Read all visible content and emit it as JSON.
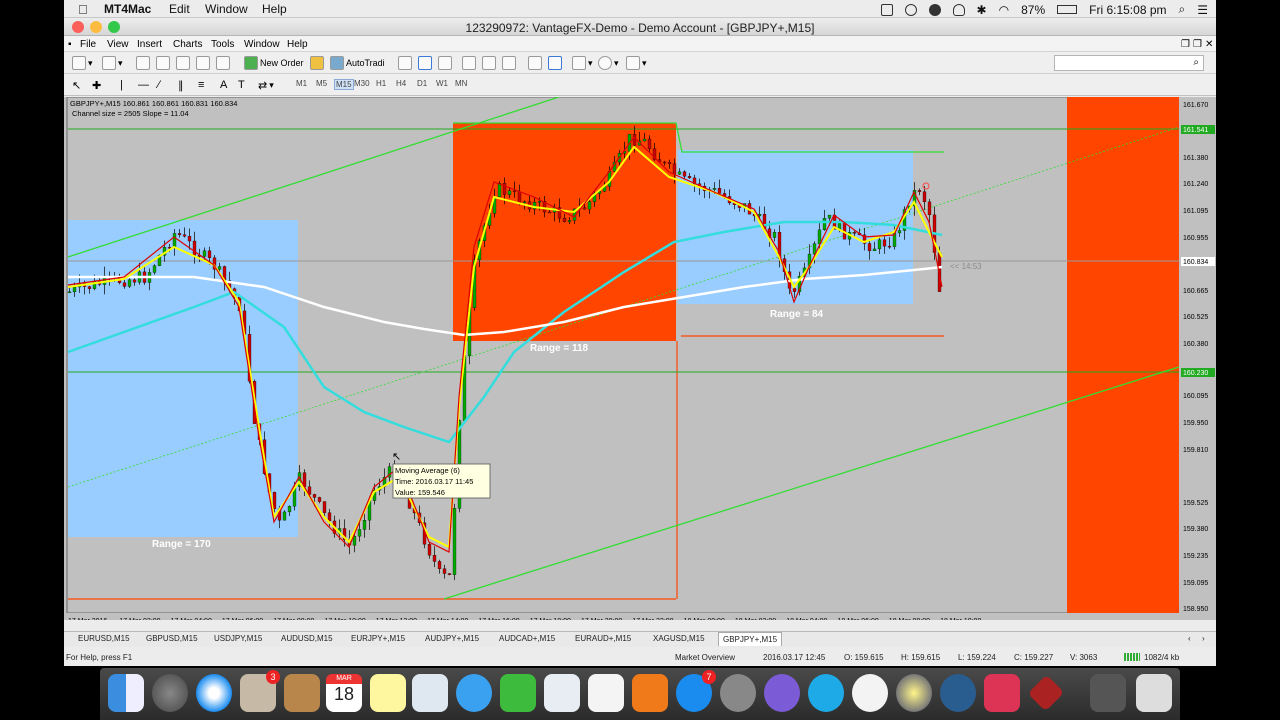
{
  "menubar": {
    "app": "MT4Mac",
    "items": [
      "Edit",
      "Window",
      "Help"
    ],
    "battery": "87%",
    "clock": "Fri 6:15:08 pm"
  },
  "window": {
    "title": "123290972: VantageFX-Demo - Demo Account - [GBPJPY+,M15]",
    "menu": [
      "File",
      "View",
      "Insert",
      "Charts",
      "Tools",
      "Window",
      "Help"
    ],
    "toolbar": {
      "new_order": "New Order",
      "autotrading": "AutoTradi"
    },
    "timeframes": [
      "M1",
      "M5",
      "M15",
      "M30",
      "H1",
      "H4",
      "D1",
      "W1",
      "MN"
    ],
    "active_timeframe": "M15"
  },
  "chart": {
    "header_line1": "GBPJPY+,M15  160.861 160.861 160.831 160.834",
    "header_line2": "Channel size = 2505  Slope = 11.04",
    "range_labels": [
      "Range = 170",
      "Range = 118",
      "Range = 84"
    ],
    "price_ticks": [
      "161.670",
      "161.380",
      "161.240",
      "161.095",
      "160.955",
      "160.665",
      "160.525",
      "160.380",
      "160.095",
      "159.950",
      "159.810",
      "159.525",
      "159.380",
      "159.235",
      "159.095",
      "158.950"
    ],
    "price_markers": [
      "161.541",
      "160.834",
      "160.230"
    ],
    "time_ticks": [
      "17 Mar 2016",
      "17 Mar 02:00",
      "17 Mar 04:00",
      "17 Mar 06:00",
      "17 Mar 08:00",
      "17 Mar 10:00",
      "17 Mar 12:00",
      "17 Mar 14:00",
      "17 Mar 16:00",
      "17 Mar 18:00",
      "17 Mar 20:00",
      "17 Mar 22:00",
      "18 Mar 00:00",
      "18 Mar 02:00",
      "18 Mar 04:00",
      "18 Mar 06:00",
      "18 Mar 08:00",
      "18 Mar 10:00"
    ],
    "countdown": "<< 14:53",
    "tooltip": {
      "line1": "Moving Average (6)",
      "line2": "Time: 2016.03.17 11:45",
      "line3": "Value: 159.546"
    },
    "colors": {
      "background": "#c0c0c0",
      "range_box_blue": "#99ccff",
      "range_box_orange": "#ff4500",
      "channel": "#33dd33",
      "ma_fast": "#ffff00",
      "ma_slow": "#ffffff",
      "ma_cyan": "#33dddd",
      "bull": "#00aa00",
      "bear": "#cc0000"
    }
  },
  "tabs": [
    "EURUSD,M15",
    "GBPUSD,M15",
    "USDJPY,M15",
    "AUDUSD,M15",
    "EURJPY+,M15",
    "AUDJPY+,M15",
    "AUDCAD+,M15",
    "EURAUD+,M15",
    "XAGUSD,M15",
    "GBPJPY+,M15"
  ],
  "active_tab": "GBPJPY+,M15",
  "status": {
    "help": "For Help, press F1",
    "profile": "Market Overview",
    "time": "2016.03.17 12:45",
    "open": "O: 159.615",
    "high": "H: 159.615",
    "low": "L: 159.224",
    "close": "C: 159.227",
    "volume": "V: 3063",
    "traffic": "1082/4 kb"
  },
  "dock": {
    "calendar_month": "MAR",
    "calendar_day": "18",
    "badges": [
      "3",
      "7"
    ]
  }
}
